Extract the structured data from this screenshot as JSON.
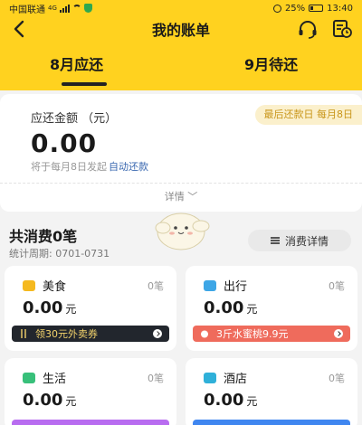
{
  "status_bar": {
    "carrier": "中国联通",
    "network": "4G",
    "battery": "25%",
    "time": "13:40"
  },
  "nav": {
    "title": "我的账单"
  },
  "tabs": [
    {
      "label": "8月应还",
      "active": true
    },
    {
      "label": "9月待还",
      "active": false
    }
  ],
  "due": {
    "label": "应还金额 （元）",
    "deadline": "最后还款日 每月8日",
    "amount": "0.00",
    "autopay_text": "将于每月8日发起",
    "autopay_link": "自动还款",
    "details": "详情 ﹀"
  },
  "summary": {
    "title": "共消费0笔",
    "period": "统计周期: 0701-0731",
    "detail_button": "消费详情"
  },
  "categories": [
    {
      "name": "美食",
      "count": "0笔",
      "amount": "0.00",
      "unit": "元",
      "promo": "领30元外卖券",
      "icon_color": "#f5b91f"
    },
    {
      "name": "出行",
      "count": "0笔",
      "amount": "0.00",
      "unit": "元",
      "promo": "3斤水蜜桃9.9元",
      "icon_color": "#3da6e6"
    },
    {
      "name": "生活",
      "count": "0笔",
      "amount": "0.00",
      "unit": "元",
      "icon_color": "#38c07a"
    },
    {
      "name": "酒店",
      "count": "0笔",
      "amount": "0.00",
      "unit": "元",
      "icon_color": "#2fb0d9"
    }
  ],
  "colors": {
    "brand_yellow": "#ffd21f",
    "link_blue": "#3a68b0",
    "deadline_gold": "#c9961a",
    "promo_red": "#ef6b5c"
  }
}
